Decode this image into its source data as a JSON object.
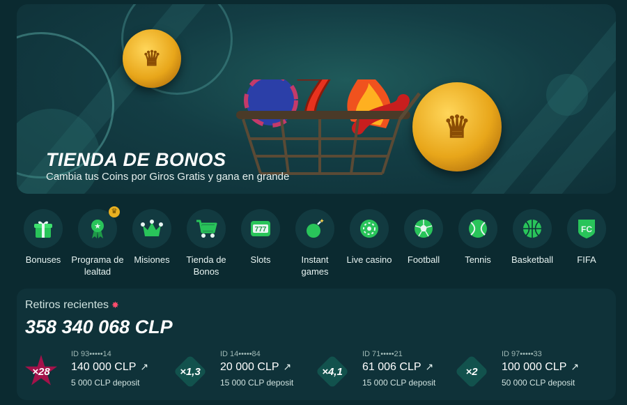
{
  "banner": {
    "title": "TIENDA DE BONOS",
    "subtitle": "Cambia tus Coins por Giros Gratis y gana en grande"
  },
  "categories": [
    {
      "label": "Bonuses",
      "icon": "gift-icon"
    },
    {
      "label": "Programa de lealtad",
      "icon": "award-ribbon-icon",
      "badge_icon": "crown-icon"
    },
    {
      "label": "Misiones",
      "icon": "crown-icon"
    },
    {
      "label": "Tienda de Bonos",
      "icon": "shopping-cart-icon"
    },
    {
      "label": "Slots",
      "icon": "slot-machine-icon"
    },
    {
      "label": "Instant games",
      "icon": "bomb-icon"
    },
    {
      "label": "Live casino",
      "icon": "roulette-icon"
    },
    {
      "label": "Football",
      "icon": "football-icon"
    },
    {
      "label": "Tennis",
      "icon": "tennis-ball-icon"
    },
    {
      "label": "Basketball",
      "icon": "basketball-icon"
    },
    {
      "label": "FIFA",
      "icon": "fc-shield-icon"
    }
  ],
  "withdrawals": {
    "title": "Retiros recientes",
    "total": "358 340 068 CLP",
    "items": [
      {
        "multiplier": "×28",
        "id": "ID 93•••••14",
        "amount": "140 000 CLP",
        "deposit": "5 000 CLP deposit",
        "color": "#a3124a"
      },
      {
        "multiplier": "×1,3",
        "id": "ID 14•••••84",
        "amount": "20 000 CLP",
        "deposit": "15 000 CLP deposit",
        "color": "#12524d"
      },
      {
        "multiplier": "×4,1",
        "id": "ID 71•••••21",
        "amount": "61 006 CLP",
        "deposit": "15 000 CLP deposit",
        "color": "#12524d"
      },
      {
        "multiplier": "×2",
        "id": "ID 97•••••33",
        "amount": "100 000 CLP",
        "deposit": "50 000 CLP deposit",
        "color": "#12524d"
      }
    ]
  },
  "colors": {
    "accent_green": "#29c45a",
    "background": "#0b2a30",
    "panel": "#0f3239"
  }
}
